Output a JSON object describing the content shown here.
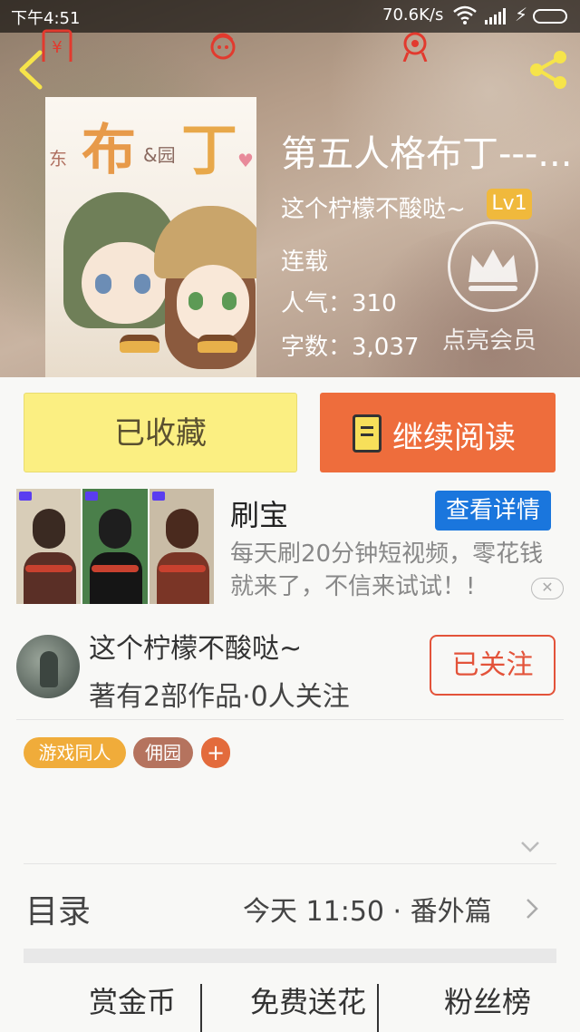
{
  "status_bar": {
    "time": "下午4:51",
    "network_speed": "70.6K/s",
    "icons": [
      "wifi-icon",
      "signal-icon",
      "charging-icon",
      "battery-icon"
    ]
  },
  "header": {
    "back_icon": "back-arrow-icon",
    "share_icon": "share-icon",
    "book_title": "第五人格布丁---...",
    "author": "这个柠檬不酸哒~",
    "author_level": "Lv1",
    "status": "连载",
    "popularity": "人气：310",
    "word_count": "字数：3,037",
    "vip_label": "点亮会员",
    "vip_icon": "crown-icon"
  },
  "cover": {
    "title_left": "布",
    "title_right": "丁",
    "amp": "&园",
    "east": "东"
  },
  "actions": {
    "favorited_label": "已收藏",
    "continue_label": "继续阅读",
    "continue_icon": "book-icon"
  },
  "ad": {
    "title": "刷宝",
    "detail_button": "查看详情",
    "description": "每天刷20分钟短视频，零花钱就来了，不信来试试！!",
    "close_icon": "close-icon"
  },
  "author_section": {
    "name": "这个柠檬不酸哒~",
    "stats": "著有2部作品·0人关注",
    "follow_label": "已关注"
  },
  "tags": [
    "游戏同人",
    "佣园",
    "+"
  ],
  "toc": {
    "label": "目录",
    "latest": "今天 11:50 · 番外篇"
  },
  "bottom_actions": [
    {
      "label": "赏金币",
      "icon": "red-envelope-icon"
    },
    {
      "label": "免费送花",
      "icon": "flower-icon"
    },
    {
      "label": "粉丝榜",
      "icon": "medal-icon"
    }
  ],
  "colors": {
    "accent_orange": "#ee6d3c",
    "favorite_yellow": "#fbef82",
    "ad_blue": "#1a76dd",
    "follow_red": "#e3533a",
    "level_gold": "#f0b93c"
  }
}
